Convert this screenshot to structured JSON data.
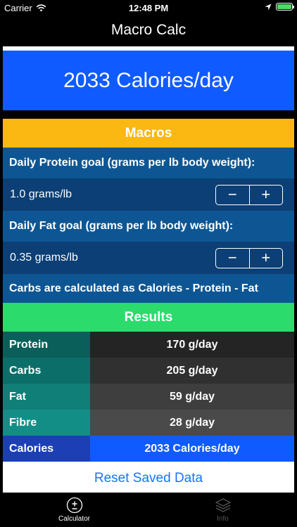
{
  "status_bar": {
    "carrier": "Carrier",
    "time": "12:48 PM"
  },
  "nav": {
    "title": "Macro Calc"
  },
  "calorie_banner": "2033 Calories/day",
  "macros": {
    "header": "Macros",
    "protein_label": "Daily Protein goal (grams per lb body weight):",
    "protein_value": "1.0 grams/lb",
    "fat_label": "Daily Fat goal (grams per lb body weight):",
    "fat_value": "0.35 grams/lb",
    "carbs_note": "Carbs are calculated as Calories - Protein - Fat",
    "minus": "−",
    "plus": "+"
  },
  "results": {
    "header": "Results",
    "rows": [
      {
        "label": "Protein",
        "value": "170 g/day",
        "label_color": "#0b5f5a",
        "value_color": "#242424"
      },
      {
        "label": "Carbs",
        "value": "205 g/day",
        "label_color": "#0c6e68",
        "value_color": "#303030"
      },
      {
        "label": "Fat",
        "value": "59 g/day",
        "label_color": "#0f7f78",
        "value_color": "#3e3e3e"
      },
      {
        "label": "Fibre",
        "value": "28 g/day",
        "label_color": "#138e86",
        "value_color": "#4a4a4a"
      },
      {
        "label": "Calories",
        "value": "2033 Calories/day",
        "label_color": "#1c3fb5",
        "value_color": "#0f5bff"
      }
    ]
  },
  "reset_label": "Reset Saved Data",
  "tabs": [
    {
      "label": "Calculator",
      "icon": "plus-minus-icon",
      "active": true
    },
    {
      "label": "Info",
      "icon": "layers-icon",
      "active": false
    }
  ],
  "colors": {
    "banner_blue": "#0f5bff",
    "macros_orange": "#fbb812",
    "results_green": "#2bdc6d",
    "link_blue": "#1475ff"
  }
}
